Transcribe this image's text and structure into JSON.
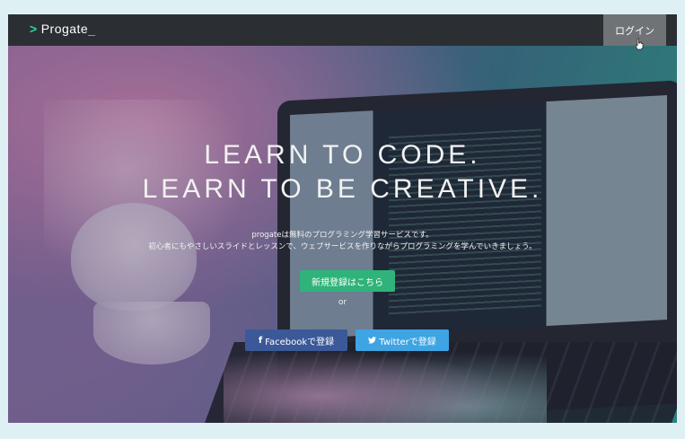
{
  "header": {
    "logo_chevron": ">",
    "logo_text": "Progate",
    "logo_cursor": "_",
    "login_label": "ログイン"
  },
  "hero": {
    "title_line1": "LEARN TO CODE.",
    "title_line2": "LEARN TO BE CREATIVE.",
    "subtitle_line1": "progateは無料のプログラミング学習サービスです。",
    "subtitle_line2": "初心者にもやさしいスライドとレッスンで、ウェブサービスを作りながらプログラミングを学んでいきましょう。",
    "signup_label": "新規登録はこちら",
    "or_label": "or",
    "facebook_icon": "f",
    "facebook_label": "Facebookで登録",
    "twitter_icon": "twitter-bird",
    "twitter_label": "Twitterで登録"
  },
  "colors": {
    "accent": "#2fd3a4",
    "signup": "#2fb37a",
    "facebook": "#3b5998",
    "twitter": "#3fa4e3",
    "topbar": "#2b2f33",
    "login_bg": "#6f7376"
  }
}
